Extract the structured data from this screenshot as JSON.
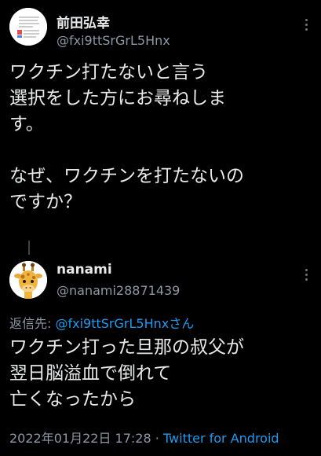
{
  "original_tweet": {
    "display_name": "前田弘幸",
    "handle": "@fxi9ttSrGrL5Hnx",
    "avatar_icon": "document-avatar-icon",
    "text": "ワクチン打たないと言う\n選択をした方にお尋ねしま\nす。\n\nなぜ、ワクチンを打たないの\nですか？"
  },
  "reply_tweet": {
    "display_name": "nanami",
    "handle": "@nanami28871439",
    "avatar_icon": "giraffe-avatar-icon",
    "reply_label": "返信先: ",
    "reply_target": "@fxi9ttSrGrL5Hnxさん",
    "text": "ワクチン打った旦那の叔父が\n翌日脳溢血で倒れて\n亡くなったから",
    "timestamp": "2022年01月22日 17:28",
    "separator": " · ",
    "source": "Twitter for Android"
  },
  "colors": {
    "background": "#000000",
    "primary_text": "#e7e9ea",
    "secondary_text": "#8b98a5",
    "link": "#1d9bf0"
  }
}
